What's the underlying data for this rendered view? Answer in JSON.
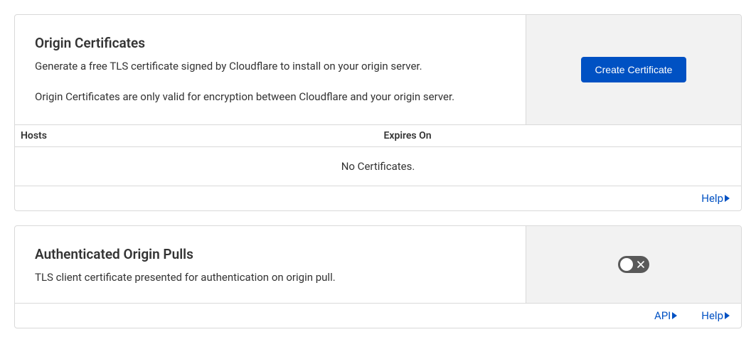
{
  "origin_certs": {
    "title": "Origin Certificates",
    "desc1": "Generate a free TLS certificate signed by Cloudflare to install on your origin server.",
    "desc2": "Origin Certificates are only valid for encryption between Cloudflare and your origin server.",
    "create_button": "Create Certificate",
    "table": {
      "col_hosts": "Hosts",
      "col_expires": "Expires On",
      "empty_text": "No Certificates."
    },
    "help_label": "Help"
  },
  "auth_origin_pulls": {
    "title": "Authenticated Origin Pulls",
    "desc": "TLS client certificate presented for authentication on origin pull.",
    "toggle_state": "off",
    "api_label": "API",
    "help_label": "Help"
  }
}
